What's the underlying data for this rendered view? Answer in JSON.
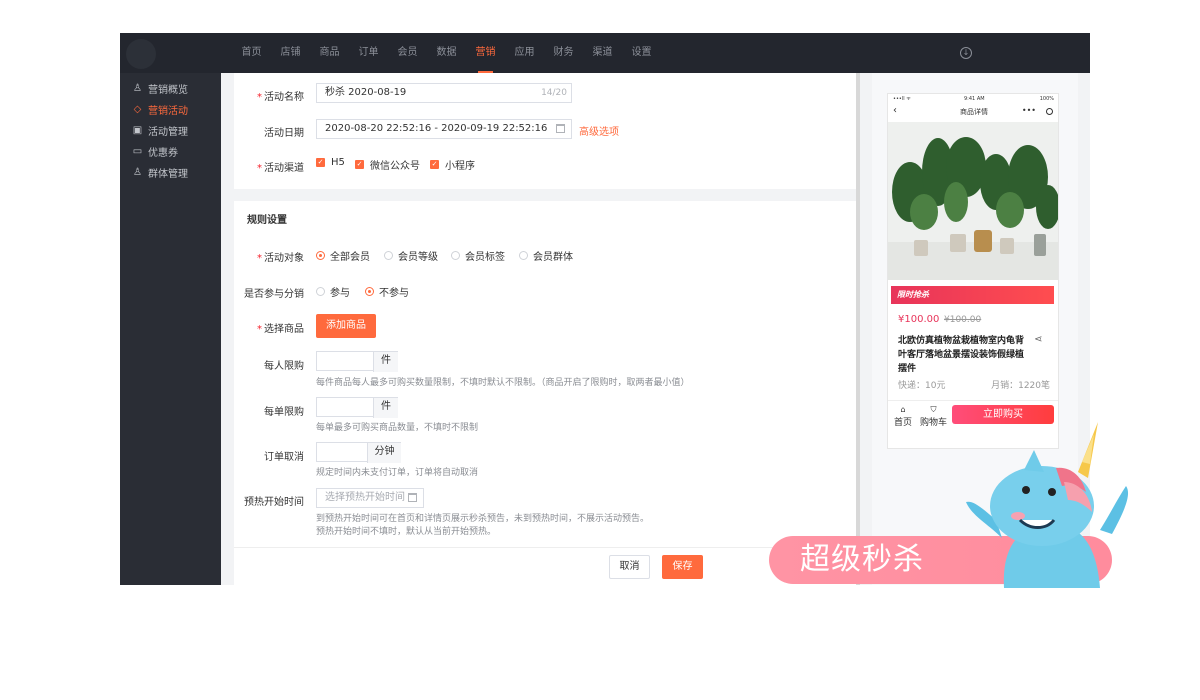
{
  "topnav": {
    "items": [
      "首页",
      "店铺",
      "商品",
      "订单",
      "会员",
      "数据",
      "营销",
      "应用",
      "财务",
      "渠道",
      "设置"
    ],
    "active_index": 6
  },
  "sidebar": {
    "items": [
      {
        "label": "营销概览",
        "icon": "user-icon"
      },
      {
        "label": "营销活动",
        "icon": "tag-icon"
      },
      {
        "label": "活动管理",
        "icon": "calendar-icon"
      },
      {
        "label": "优惠券",
        "icon": "coupon-icon"
      },
      {
        "label": "群体管理",
        "icon": "group-icon"
      }
    ],
    "active_index": 1
  },
  "form": {
    "name_label": "活动名称",
    "name_value": "秒杀  2020-08-19",
    "name_counter": "14/20",
    "date_label": "活动日期",
    "date_value": "2020-08-20 22:52:16 - 2020-09-19 22:52:16",
    "advanced_link": "高级选项",
    "channel_label": "活动渠道",
    "channels": [
      "H5",
      "微信公众号",
      "小程序"
    ]
  },
  "rules": {
    "title": "规则设置",
    "target_label": "活动对象",
    "target_options": [
      "全部会员",
      "会员等级",
      "会员标签",
      "会员群体"
    ],
    "target_selected": 0,
    "distribution_label": "是否参与分销",
    "distribution_options": [
      "参与",
      "不参与"
    ],
    "distribution_selected": 1,
    "goods_label": "选择商品",
    "goods_button": "添加商品",
    "per_person_label": "每人限购",
    "per_person_unit": "件",
    "per_person_hint": "每件商品每人最多可购买数量限制，不填时默认不限制。（商品开启了限购时，取两者最小值）",
    "per_order_label": "每单限购",
    "per_order_unit": "件",
    "per_order_hint": "每单最多可购买商品数量，不填时不限制",
    "cancel_label": "订单取消",
    "cancel_unit": "分钟",
    "cancel_hint": "规定时间内未支付订单，订单将自动取消",
    "preheat_label": "预热开始时间",
    "preheat_placeholder": "选择预热开始时间",
    "preheat_hint1": "到预热开始时间可在首页和详情页展示秒杀预告，未到预热时间，不展示活动预告。",
    "preheat_hint2": "预热开始时间不填时，默认从当前开始预热。"
  },
  "footer": {
    "cancel": "取消",
    "save": "保存"
  },
  "phone": {
    "status_time": "9:41 AM",
    "status_battery": "100%",
    "status_signal": "•••ll ᯤ",
    "title": "商品详情",
    "flash_tag": "限时抢杀",
    "price": "¥100.00",
    "orig_price": "¥100.00",
    "product_name": "北欧仿真植物盆栽植物室内龟背叶客厅落地盆景摆设装饰假绿植摆件",
    "shipping": "快递：10元",
    "sales": "月销：1220笔",
    "tab_home": "首页",
    "tab_cart": "购物车",
    "buy": "立即购买"
  },
  "promo": {
    "text": "超级秒杀"
  },
  "colors": {
    "accent": "#ff6a3d",
    "sidebar_bg": "#2a2d35",
    "topbar_bg": "#23262e",
    "promo_pink": "#ff8c9d"
  }
}
